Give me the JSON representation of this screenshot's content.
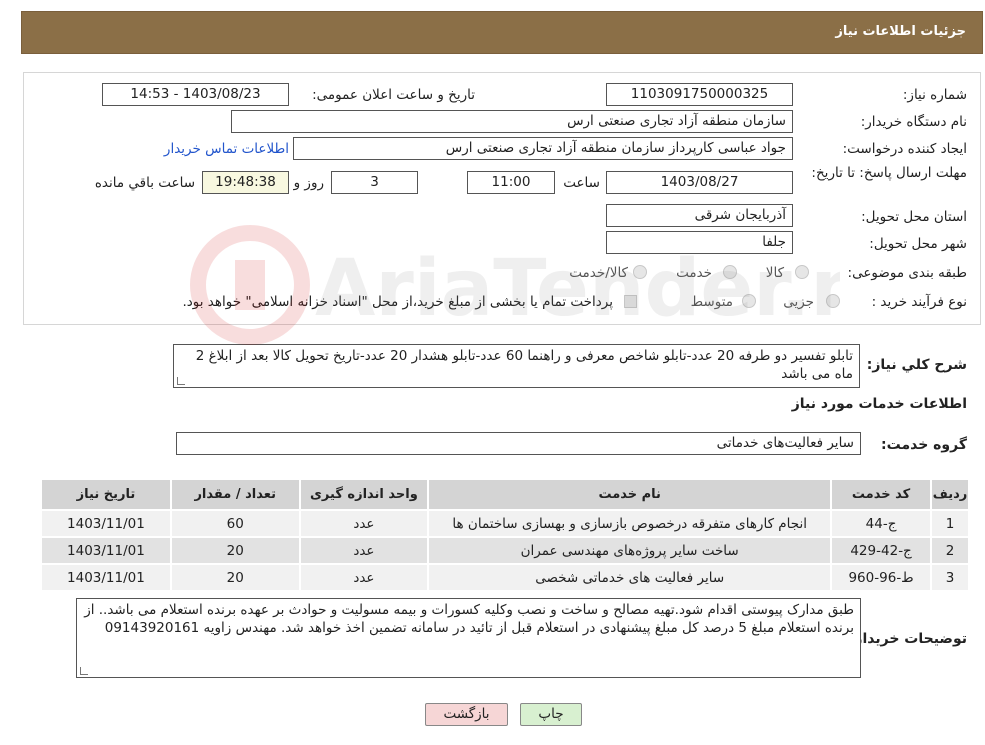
{
  "header": {
    "title": "جزئیات اطلاعات نیاز"
  },
  "form": {
    "need_number": {
      "label": "شماره نیاز:",
      "value": "1103091750000325"
    },
    "announce_datetime": {
      "label": "تاریخ و ساعت اعلان عمومی:",
      "value": "1403/08/23 - 14:53"
    },
    "buyer_org": {
      "label": "نام دستگاه خریدار:",
      "value": "سازمان منطقه آزاد تجاری صنعتی ارس"
    },
    "requester": {
      "label": "ایجاد کننده درخواست:",
      "value": "جواد عباسی کارپرداز سازمان منطقه آزاد تجاری صنعتی ارس",
      "contact_link": "اطلاعات تماس خریدار"
    },
    "deadline": {
      "label": "مهلت ارسال پاسخ: تا تاریخ:",
      "date": "1403/08/27",
      "time_label": "ساعت",
      "time": "11:00",
      "days": "3",
      "days_label": "روز و",
      "remaining": "19:48:38",
      "remaining_label": "ساعت باقي مانده"
    },
    "province": {
      "label": "استان محل تحویل:",
      "value": "آذربایجان شرقی"
    },
    "city": {
      "label": "شهر محل تحویل:",
      "value": "جلفا"
    },
    "category": {
      "label": "طبقه بندی موضوعی:",
      "options": [
        "کالا",
        "خدمت",
        "کالا/خدمت"
      ]
    },
    "process": {
      "label": "نوع فرآیند خرید :",
      "options": [
        "جزیی",
        "متوسط"
      ],
      "note": "پرداخت تمام یا بخشی از مبلغ خرید،از محل \"اسناد خزانه اسلامی\" خواهد بود."
    }
  },
  "summary": {
    "label": "شرح کلي نياز:",
    "text": "تابلو تفسیر دو طرفه 20 عدد-تابلو شاخص معرفی و راهنما 60 عدد-تابلو هشدار 20 عدد-تاریخ تحویل کالا بعد از ابلاغ 2 ماه می باشد"
  },
  "services_section": {
    "title": "اطلاعات خدمات مورد نياز",
    "group_label": "گروه خدمت:",
    "group_value": "سایر فعالیت‌های خدماتی"
  },
  "table": {
    "headers": [
      "رديف",
      "کد خدمت",
      "نام خدمت",
      "واحد اندازه گيری",
      "تعداد / مقدار",
      "تاريخ نياز"
    ],
    "rows": [
      {
        "row": "1",
        "code": "ج-44",
        "name": "انجام کارهای متفرقه درخصوص بازسازی و بهسازی ساختمان ها",
        "unit": "عدد",
        "qty": "60",
        "date": "1403/11/01"
      },
      {
        "row": "2",
        "code": "ج-42-429",
        "name": "ساخت سایر پروژه‌های مهندسی عمران",
        "unit": "عدد",
        "qty": "20",
        "date": "1403/11/01"
      },
      {
        "row": "3",
        "code": "ط-96-960",
        "name": "سایر فعالیت های خدماتی شخصی",
        "unit": "عدد",
        "qty": "20",
        "date": "1403/11/01"
      }
    ]
  },
  "buyer_notes": {
    "label": "توضیحات خریدار:",
    "text": "طبق مدارک پیوستی اقدام شود.تهیه مصالح و ساخت و نصب وکلیه کسورات و بیمه مسولیت و حوادث بر عهده برنده استعلام می باشد.. از برنده استعلام مبلغ 5 درصد کل مبلغ پیشنهادی در استعلام قبل از تائید در سامانه تضمین اخذ خواهد شد. مهندس زاویه 09143920161"
  },
  "buttons": {
    "print": "چاپ",
    "back": "بازگشت"
  },
  "watermark": {
    "text": "AriaTender.neT"
  },
  "colors": {
    "header_bg": "#8b6f47",
    "back_button_bg": "#f6d6d6",
    "print_button_bg": "#d8f0d0",
    "link": "#2255cc"
  }
}
